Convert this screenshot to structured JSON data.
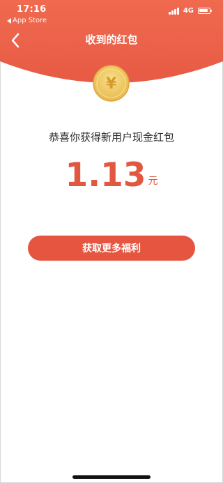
{
  "status_bar": {
    "time": "17:16",
    "back_app_label": "App Store",
    "network": "4G"
  },
  "nav": {
    "title": "收到的红包"
  },
  "coin": {
    "symbol": "¥"
  },
  "main": {
    "message": "恭喜你获得新用户现金红包",
    "amount": "1.13",
    "amount_unit": "元",
    "cta_label": "获取更多福利"
  },
  "colors": {
    "header_top": "#f06a4f",
    "header_bottom": "#e75a45",
    "accent": "#e2573f",
    "coin_outer": "#f5d76e",
    "coin_inner": "#e0a63c"
  }
}
